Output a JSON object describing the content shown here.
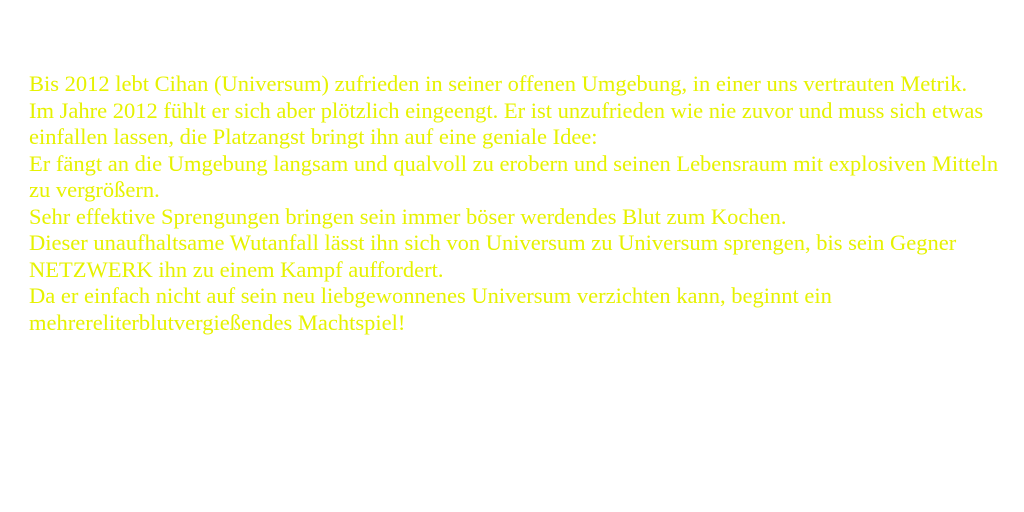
{
  "colors": {
    "background": "#ffffff",
    "text": "#e6f200"
  },
  "story": {
    "paragraphs": [
      "Bis 2012 lebt Cihan (Universum) zufrieden in seiner offenen Umgebung, in einer uns vertrauten Metrik.",
      "Im Jahre 2012 fühlt er sich aber plötzlich eingeengt. Er ist unzufrieden wie nie zuvor und muss sich etwas einfallen lassen, die Platzangst bringt ihn auf eine geniale Idee:",
      "Er fängt an die Umgebung langsam und qualvoll zu erobern und seinen Lebensraum mit explosiven Mitteln zu vergrößern.",
      "Sehr effektive Sprengungen bringen sein immer böser werdendes Blut zum Kochen.",
      "Dieser unaufhaltsame Wutanfall lässt ihn sich von Universum zu Universum sprengen, bis sein Gegner NETZWERK ihn zu einem Kampf auffordert.",
      "Da er einfach nicht auf sein neu liebgewonnenes Universum verzichten kann, beginnt ein mehrereliterblutvergießendes Machtspiel!"
    ]
  }
}
